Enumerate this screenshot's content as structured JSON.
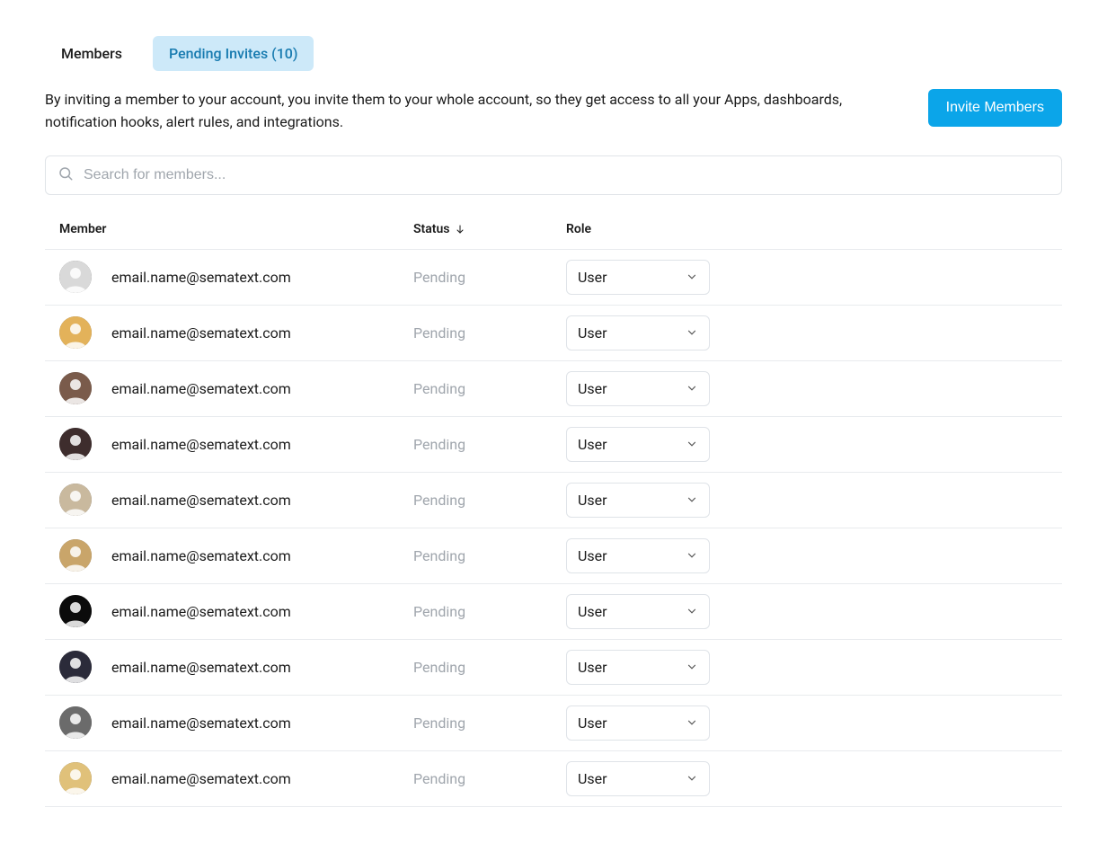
{
  "tabs": {
    "members": "Members",
    "pending": "Pending Invites (10)"
  },
  "description": "By inviting a member to your account, you invite them to your whole account, so they get access to all your Apps, dashboards, notification hooks, alert rules, and integrations.",
  "invite_button": "Invite Members",
  "search": {
    "placeholder": "Search for members..."
  },
  "columns": {
    "member": "Member",
    "status": "Status",
    "role": "Role"
  },
  "sort": {
    "column": "status",
    "direction": "desc"
  },
  "colors": {
    "accent": "#0ba5e9",
    "tab_active_bg": "#cde9f9",
    "tab_active_fg": "#187bb0",
    "muted": "#a0a6ad",
    "border": "#e0e4e8"
  },
  "role_options": [
    "User"
  ],
  "rows": [
    {
      "email": "email.name@sematext.com",
      "status": "Pending",
      "role": "User",
      "avatar_bg": "#d9d9d9"
    },
    {
      "email": "email.name@sematext.com",
      "status": "Pending",
      "role": "User",
      "avatar_bg": "#e3b25a"
    },
    {
      "email": "email.name@sematext.com",
      "status": "Pending",
      "role": "User",
      "avatar_bg": "#7a5b4b"
    },
    {
      "email": "email.name@sematext.com",
      "status": "Pending",
      "role": "User",
      "avatar_bg": "#3e2d2d"
    },
    {
      "email": "email.name@sematext.com",
      "status": "Pending",
      "role": "User",
      "avatar_bg": "#c9b99e"
    },
    {
      "email": "email.name@sematext.com",
      "status": "Pending",
      "role": "User",
      "avatar_bg": "#c9a56a"
    },
    {
      "email": "email.name@sematext.com",
      "status": "Pending",
      "role": "User",
      "avatar_bg": "#0b0b0b"
    },
    {
      "email": "email.name@sematext.com",
      "status": "Pending",
      "role": "User",
      "avatar_bg": "#2b2b3a"
    },
    {
      "email": "email.name@sematext.com",
      "status": "Pending",
      "role": "User",
      "avatar_bg": "#6b6b6b"
    },
    {
      "email": "email.name@sematext.com",
      "status": "Pending",
      "role": "User",
      "avatar_bg": "#e0c17a"
    }
  ]
}
